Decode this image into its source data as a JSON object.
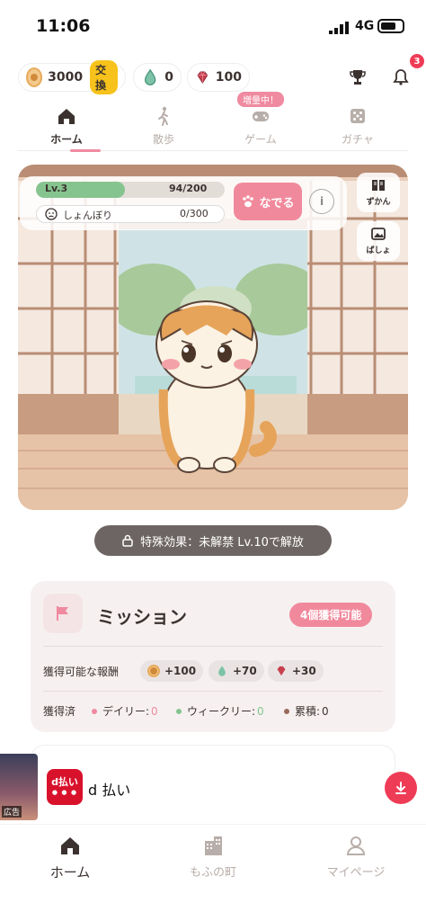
{
  "status_bar": {
    "time": "11:06",
    "network": "4G"
  },
  "currency": {
    "coins": "3000",
    "exchange_label": "交換",
    "drops": "0",
    "gems": "100",
    "notification_count": "3"
  },
  "tabs": [
    {
      "label": "ホーム",
      "active": true,
      "icon": "home-icon"
    },
    {
      "label": "散歩",
      "active": false,
      "icon": "walk-icon"
    },
    {
      "label": "ゲーム",
      "active": false,
      "icon": "gamepad-icon"
    },
    {
      "label": "ガチャ",
      "active": false,
      "icon": "dice-icon"
    }
  ],
  "event_tag": "増量中！",
  "cat_status": {
    "level_label": "Lv.3",
    "exp_text": "94/200",
    "exp_fraction": 0.47,
    "mood_label": "しょんぼり",
    "mood_text": "0/300",
    "pet_button": "なでる",
    "info_button": "i"
  },
  "side_buttons": [
    {
      "label": "ずかん",
      "icon": "book-icon"
    },
    {
      "label": "ばしょ",
      "icon": "picture-icon"
    }
  ],
  "special_effect": "特殊効果：未解禁 Lv.10で解放",
  "mission": {
    "title": "ミッション",
    "available_badge": "4個獲得可能",
    "rewards_label": "獲得可能な報酬",
    "rewards": [
      {
        "value": "+100",
        "icon": "coin-icon"
      },
      {
        "value": "+70",
        "icon": "drop-icon"
      },
      {
        "value": "+30",
        "icon": "gem-icon"
      }
    ],
    "earned_label": "獲得済",
    "earned": [
      {
        "label": "デイリー:",
        "value": "0",
        "color": "#ef8aa0"
      },
      {
        "label": "ウィークリー:",
        "value": "0",
        "color": "#86c48f"
      },
      {
        "label": "累積:",
        "value": "0",
        "color": "#9a6a5a"
      }
    ]
  },
  "ad": {
    "tag": "広告",
    "logo_text": "d払い",
    "name": "d 払い"
  },
  "bottom_nav": [
    {
      "label": "ホーム",
      "active": true,
      "icon": "home-icon"
    },
    {
      "label": "もふの町",
      "active": false,
      "icon": "building-icon"
    },
    {
      "label": "マイページ",
      "active": false,
      "icon": "person-icon"
    }
  ],
  "colors": {
    "accent_pink": "#f1899c",
    "exp_green": "#86c48f",
    "alert_red": "#ef3c56"
  }
}
